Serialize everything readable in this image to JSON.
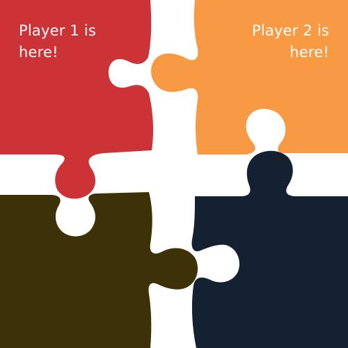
{
  "colors": {
    "red": "#cc3336",
    "orange": "#f79a43",
    "olive": "#3c3107",
    "navy": "#142133",
    "background": "#ffffff"
  },
  "pieces": [
    {
      "name": "top-left",
      "color": "#cc3336"
    },
    {
      "name": "top-right",
      "color": "#f79a43"
    },
    {
      "name": "bottom-left",
      "color": "#3c3107"
    },
    {
      "name": "bottom-right",
      "color": "#142133"
    }
  ],
  "player1": {
    "line1": "Player 1 is",
    "line2": "here!"
  },
  "player2": {
    "line1": "Player 2 is",
    "line2": "here!"
  }
}
